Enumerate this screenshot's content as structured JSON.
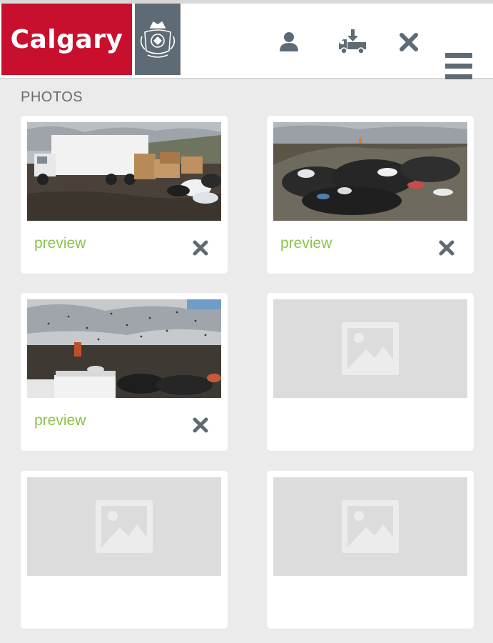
{
  "header": {
    "logo_text": "Calgary",
    "brand_color": "#c8102e",
    "crest_bg": "#5f6b74",
    "icons": [
      "user-icon",
      "truck-download-icon",
      "close-icon",
      "hamburger-menu-icon"
    ]
  },
  "photos": {
    "title": "PHOTOS",
    "accent_color": "#8bc34a",
    "cards": [
      {
        "has_photo": true,
        "preview_label": "preview",
        "scene": "truck-with-boxes"
      },
      {
        "has_photo": true,
        "preview_label": "preview",
        "scene": "landfill-garbage"
      },
      {
        "has_photo": true,
        "preview_label": "preview",
        "scene": "landfill-with-birds"
      },
      {
        "has_photo": false
      },
      {
        "has_photo": false
      },
      {
        "has_photo": false
      }
    ]
  }
}
